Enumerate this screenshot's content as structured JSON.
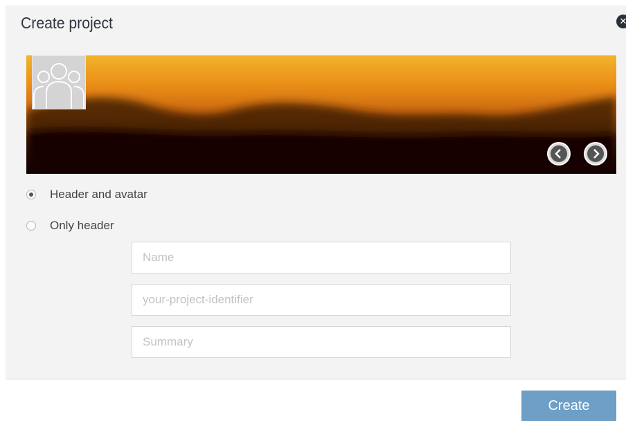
{
  "dialog": {
    "title": "Create project",
    "close_icon": "close-icon"
  },
  "banner": {
    "avatar_icon": "group-users-icon",
    "prev_icon": "chevron-left-icon",
    "next_icon": "chevron-right-icon"
  },
  "layout_options": [
    {
      "label": "Header and avatar",
      "checked": true
    },
    {
      "label": "Only header",
      "checked": false
    }
  ],
  "form": {
    "name": {
      "placeholder": "Name",
      "value": ""
    },
    "identifier": {
      "placeholder": "your-project-identifier",
      "value": ""
    },
    "summary": {
      "placeholder": "Summary",
      "value": ""
    }
  },
  "footer": {
    "create_label": "Create"
  },
  "colors": {
    "accent": "#6d9fc7",
    "dialog_bg": "#f3f3f3",
    "close_bg": "#2a2f3a"
  }
}
